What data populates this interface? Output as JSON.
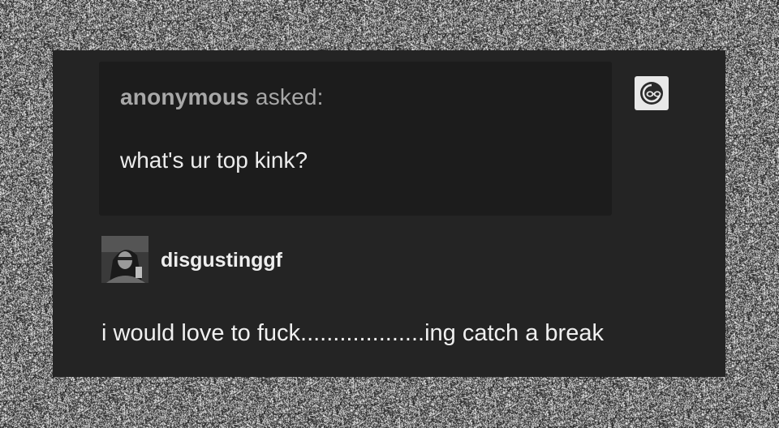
{
  "background": {
    "style": "tv-static-noise"
  },
  "post": {
    "ask": {
      "asker_name": "anonymous",
      "asked_label": " asked:",
      "question": "what's ur top kink?",
      "asker_avatar_icon": "anon-sunglasses-icon"
    },
    "answer": {
      "blog_name": "disgustinggf",
      "avatar_icon": "user-avatar",
      "text": "i would love to fuck...................ing catch a break"
    }
  },
  "colors": {
    "card_bg": "#242424",
    "ask_box_bg": "#1c1c1c",
    "muted_text": "#a8a8a8",
    "primary_text": "#f0f0f0"
  }
}
